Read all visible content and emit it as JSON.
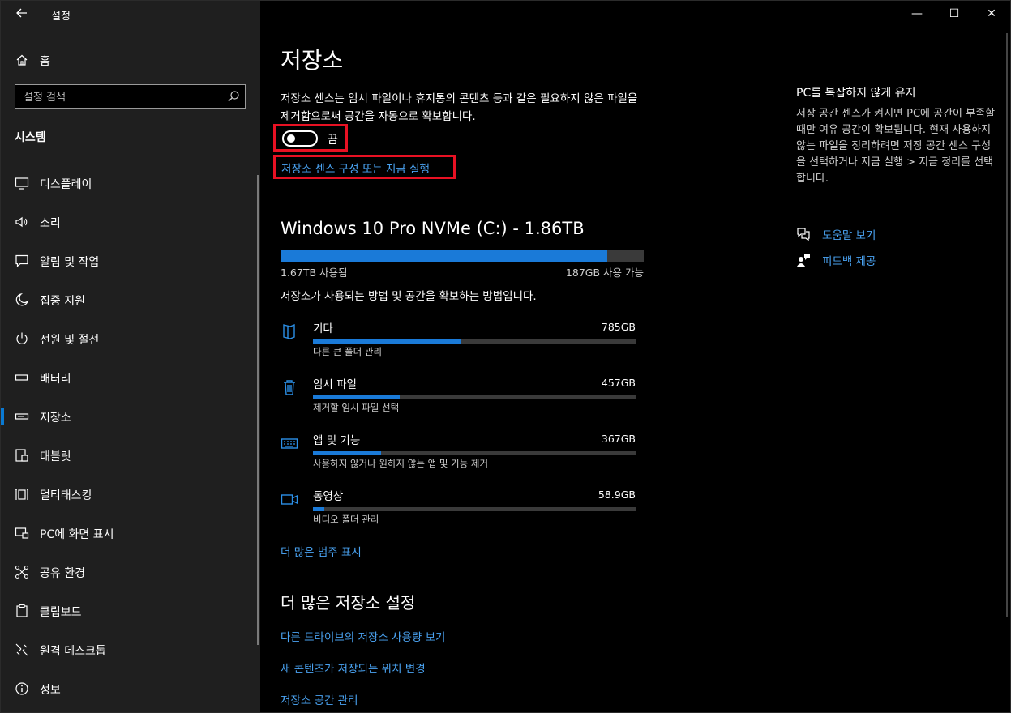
{
  "window": {
    "title": "설정",
    "back_icon": "back-arrow-icon",
    "controls": {
      "minimize": "—",
      "maximize": "☐",
      "close": "✕"
    }
  },
  "sidebar": {
    "home_label": "홈",
    "search_placeholder": "설정 검색",
    "section_title": "시스템",
    "items": [
      {
        "label": "디스플레이",
        "icon": "monitor-icon"
      },
      {
        "label": "소리",
        "icon": "speaker-icon"
      },
      {
        "label": "알림 및 작업",
        "icon": "notification-icon"
      },
      {
        "label": "집중 지원",
        "icon": "moon-icon"
      },
      {
        "label": "전원 및 절전",
        "icon": "power-icon"
      },
      {
        "label": "배터리",
        "icon": "battery-icon"
      },
      {
        "label": "저장소",
        "icon": "storage-icon",
        "active": true
      },
      {
        "label": "태블릿",
        "icon": "tablet-icon"
      },
      {
        "label": "멀티태스킹",
        "icon": "multitasking-icon"
      },
      {
        "label": "PC에 화면 표시",
        "icon": "project-icon"
      },
      {
        "label": "공유 환경",
        "icon": "share-icon"
      },
      {
        "label": "클립보드",
        "icon": "clipboard-icon"
      },
      {
        "label": "원격 데스크톱",
        "icon": "remote-desktop-icon"
      },
      {
        "label": "정보",
        "icon": "info-icon"
      }
    ]
  },
  "main": {
    "title": "저장소",
    "description": "저장소 센스는 임시 파일이나 휴지통의 콘텐츠 등과 같은 필요하지 않은 파일을 제거함으로써 공간을 자동으로 확보합니다.",
    "toggle": {
      "state_label": "끔",
      "on": false
    },
    "configure_link": "저장소 센스 구성 또는 지금 실행",
    "drive": {
      "title": "Windows 10 Pro NVMe (C:) - 1.86TB",
      "used_label": "1.67TB 사용됨",
      "free_label": "187GB 사용 가능",
      "used_fraction": 0.9
    },
    "usage_desc": "저장소가 사용되는 방법 및 공간을 확보하는 방법입니다.",
    "categories": [
      {
        "name": "기타",
        "size": "785GB",
        "sub": "다른 큰 폴더 관리",
        "fraction": 0.46,
        "icon": "folder-icon"
      },
      {
        "name": "임시 파일",
        "size": "457GB",
        "sub": "제거할 임시 파일 선택",
        "fraction": 0.27,
        "icon": "trash-icon"
      },
      {
        "name": "앱 및 기능",
        "size": "367GB",
        "sub": "사용하지 않거나 원하지 않는 앱 및 기능 제거",
        "fraction": 0.21,
        "icon": "keyboard-icon"
      },
      {
        "name": "동영상",
        "size": "58.9GB",
        "sub": "비디오 폴더 관리",
        "fraction": 0.035,
        "icon": "video-icon"
      }
    ],
    "more_categories": "더 많은 범주 표시",
    "more_settings_title": "더 많은 저장소 설정",
    "more_settings": [
      "다른 드라이브의 저장소 사용량 보기",
      "새 콘텐츠가 저장되는 위치 변경",
      "저장소 공간 관리"
    ]
  },
  "aside": {
    "title": "PC를 복잡하지 않게 유지",
    "description": "저장 공간 센스가 켜지면 PC에 공간이 부족할 때만 여유 공간이 확보됩니다. 현재 사용하지 않는 파일을 정리하려면 저장 공간 센스 구성을 선택하거나 지금 실행 > 지금 정리를 선택합니다.",
    "help_link": "도움말 보기",
    "feedback_link": "피드백 제공"
  },
  "colors": {
    "accent": "#1a7ad8",
    "link": "#4aa3f2",
    "highlight_box": "#e81123"
  }
}
